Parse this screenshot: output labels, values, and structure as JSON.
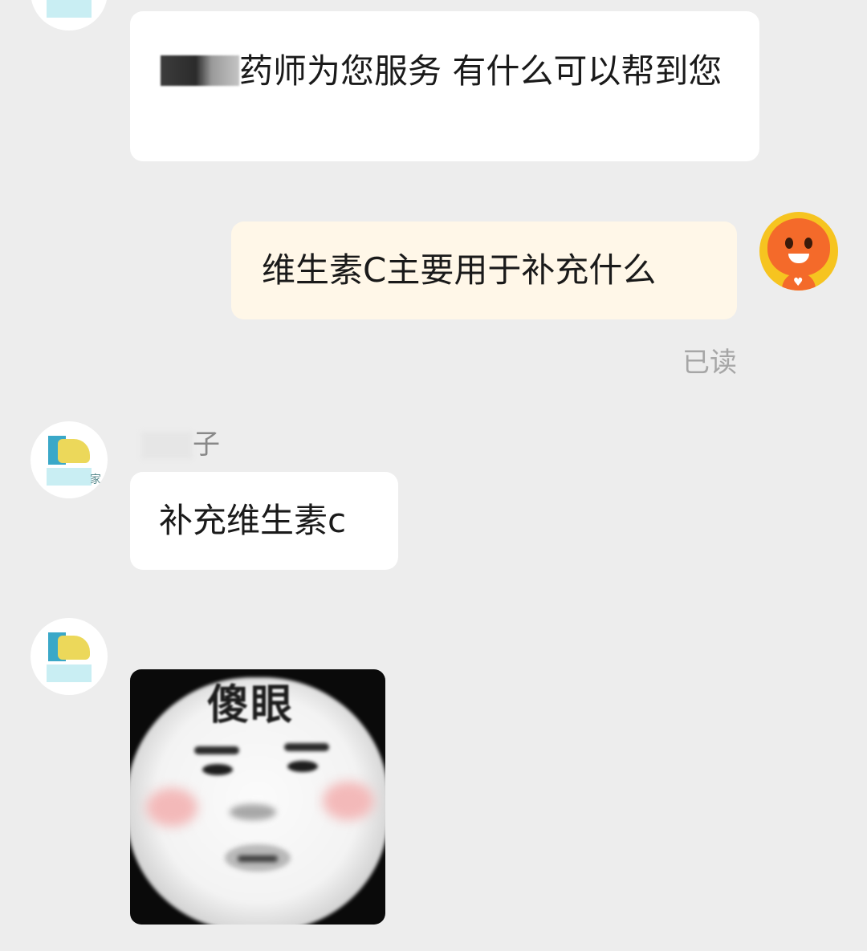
{
  "messages": {
    "pharmacist_greeting": {
      "text_before_redaction": "",
      "text_after_redaction": "药师为您服务 有什么可以帮到您"
    },
    "user_question": {
      "text": "维生素C主要用于补充什么",
      "status": "已读"
    },
    "pharmacist_reply": {
      "sender_name_visible": "子",
      "text": "补充维生素c"
    },
    "sticker": {
      "caption": "傻眼"
    }
  },
  "avatars": {
    "pharmacy_store_tag": "家"
  },
  "colors": {
    "background": "#ededed",
    "incoming_bubble": "#ffffff",
    "outgoing_bubble": "#fff7e8",
    "read_status": "#a6a6a6",
    "user_avatar_ring": "#f6c420",
    "user_avatar_face": "#f46a2a"
  },
  "icons": {
    "user_avatar": "orange-mascot-avatar-icon",
    "store_avatar": "pharmacy-logo-avatar-icon"
  }
}
